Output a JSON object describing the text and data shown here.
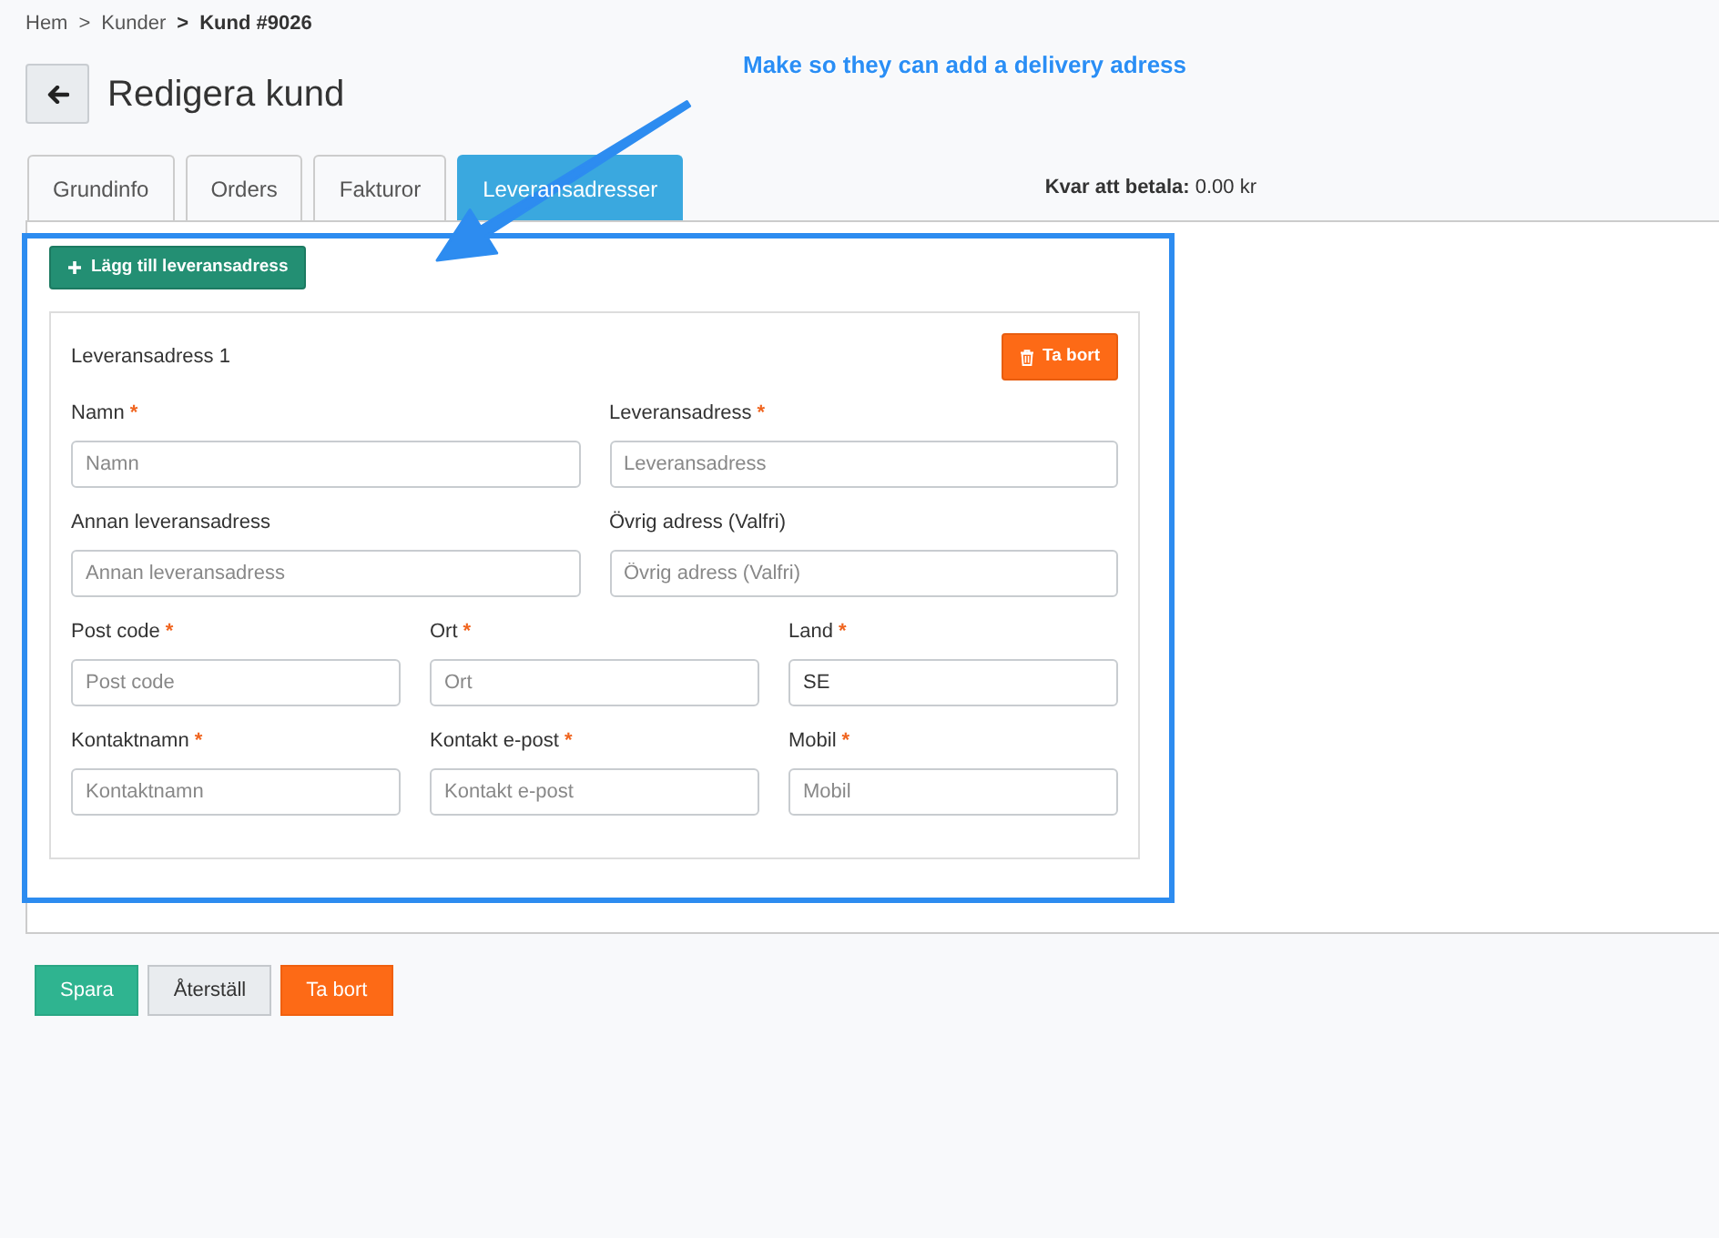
{
  "breadcrumb": [
    {
      "label": "Hem",
      "current": false
    },
    {
      "label": "Kunder",
      "current": false,
      "separator": ">"
    },
    {
      "label": "Kund #9026",
      "current": true,
      "separator": ">"
    }
  ],
  "header": {
    "title": "Redigera kund"
  },
  "annotation": {
    "text": "Make so they can add a delivery adress"
  },
  "tabs": [
    {
      "label": "Grundinfo",
      "selected": false
    },
    {
      "label": "Orders",
      "selected": false
    },
    {
      "label": "Fakturor",
      "selected": false
    },
    {
      "label": "Leveransadresser",
      "selected": true
    }
  ],
  "balance": {
    "label": "Kvar att betala:",
    "value": "0.00 kr"
  },
  "add_button": {
    "label": "Lägg till leveransadress"
  },
  "addresses": [
    {
      "title": "Leveransadress 1",
      "delete_button": {
        "label": "Ta bort"
      },
      "rows": [
        [
          {
            "label": "Namn",
            "required_mark": "*",
            "placeholder": "Namn"
          },
          {
            "label": "Leveransadress",
            "required_mark": "*",
            "placeholder": "Leveransadress"
          }
        ],
        [
          {
            "label": "Annan leveransadress",
            "placeholder": "Annan leveransadress"
          },
          {
            "label": "Övrig adress (Valfri)",
            "placeholder": "Övrig adress (Valfri)"
          }
        ],
        [
          {
            "label": "Post code",
            "required_mark": "*",
            "placeholder": "Post code"
          },
          {
            "label": "Ort",
            "required_mark": "*",
            "placeholder": "Ort"
          },
          {
            "label": "Land",
            "required_mark": "*",
            "value": "SE"
          }
        ],
        [
          {
            "label": "Kontaktnamn",
            "required_mark": "*",
            "placeholder": "Kontaktnamn"
          },
          {
            "label": "Kontakt e-post",
            "required_mark": "*",
            "placeholder": "Kontakt e-post"
          },
          {
            "label": "Mobil",
            "required_mark": "*",
            "placeholder": "Mobil"
          }
        ]
      ]
    }
  ],
  "footer_buttons": [
    {
      "label": "Spara",
      "kind": "primary"
    },
    {
      "label": "Återställ",
      "kind": "secondary"
    },
    {
      "label": "Ta bort",
      "kind": "danger"
    }
  ]
}
